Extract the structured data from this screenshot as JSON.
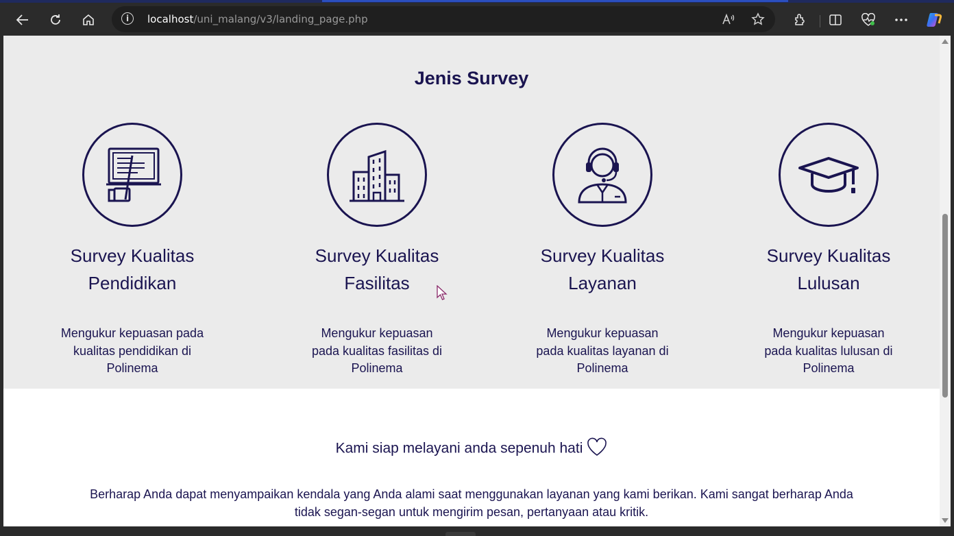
{
  "browser": {
    "url_host": "localhost",
    "url_path": "/uni_malang/v3/landing_page.php"
  },
  "survey": {
    "title": "Jenis Survey",
    "cards": [
      {
        "icon": "presentation-board-icon",
        "title_line1": "Survey Kualitas",
        "title_line2": "Pendidikan",
        "desc_line1": "Mengukur kepuasan pada",
        "desc_line2": "kualitas pendidikan di",
        "desc_line3": "Polinema"
      },
      {
        "icon": "buildings-icon",
        "title_line1": "Survey Kualitas",
        "title_line2": "Fasilitas",
        "desc_line1": "Mengukur kepuasan",
        "desc_line2": "pada kualitas fasilitas di",
        "desc_line3": "Polinema"
      },
      {
        "icon": "customer-service-icon",
        "title_line1": "Survey Kualitas",
        "title_line2": "Layanan",
        "desc_line1": "Mengukur kepuasan",
        "desc_line2": "pada kualitas layanan di",
        "desc_line3": "Polinema"
      },
      {
        "icon": "graduation-cap-icon",
        "title_line1": "Survey Kualitas",
        "title_line2": "Lulusan",
        "desc_line1": "Mengukur kepuasan",
        "desc_line2": "pada kualitas lulusan di",
        "desc_line3": "Polinema"
      }
    ]
  },
  "contact": {
    "tagline": "Kami siap melayani anda sepenuh hati",
    "paragraph_line1": "Berharap Anda dapat menyampaikan kendala yang Anda alami saat menggunakan layanan yang kami berikan. Kami sangat berharap Anda",
    "paragraph_line2": "tidak segan-segan untuk mengirim pesan, pertanyaan atau kritik."
  },
  "colors": {
    "primary": "#1a1450",
    "section_bg": "#ebebeb",
    "browser_chrome": "#2b2b2b"
  }
}
